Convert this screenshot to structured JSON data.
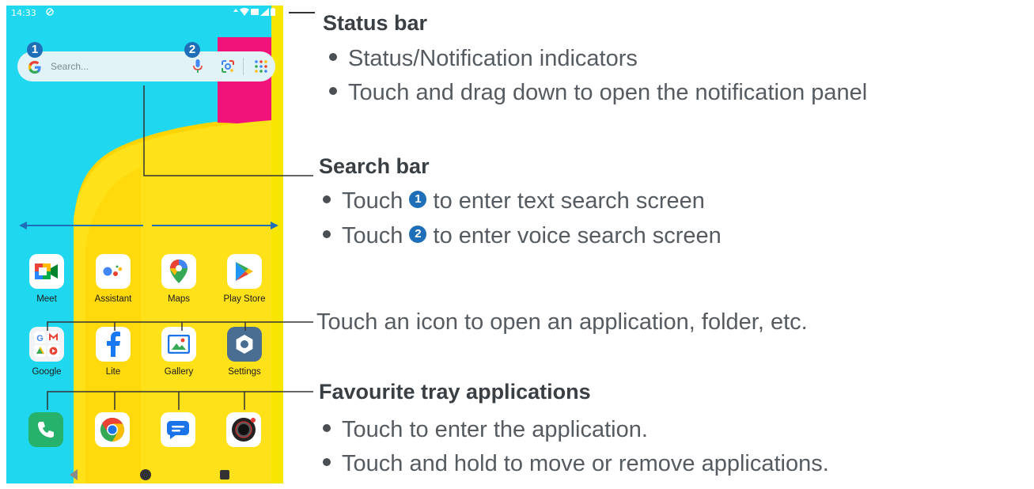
{
  "status_bar": {
    "time": "14:33"
  },
  "search_bar": {
    "placeholder": "Search...",
    "badge_1": "1",
    "badge_2": "2"
  },
  "home_apps": [
    {
      "label": "Meet",
      "icon": "meet-icon"
    },
    {
      "label": "Assistant",
      "icon": "assistant-icon"
    },
    {
      "label": "Maps",
      "icon": "maps-icon"
    },
    {
      "label": "Play Store",
      "icon": "play-store-icon"
    },
    {
      "label": "Google",
      "icon": "google-folder-icon"
    },
    {
      "label": "Lite",
      "icon": "facebook-lite-icon"
    },
    {
      "label": "Gallery",
      "icon": "gallery-icon"
    },
    {
      "label": "Settings",
      "icon": "settings-icon"
    }
  ],
  "dock_apps": [
    {
      "icon": "phone-icon"
    },
    {
      "icon": "chrome-icon"
    },
    {
      "icon": "messages-icon"
    },
    {
      "icon": "camera-icon"
    }
  ],
  "annotations": {
    "status_bar": {
      "title": "Status bar",
      "bullets": [
        "Status/Notification indicators",
        "Touch and drag down to open the notification panel"
      ]
    },
    "search_bar": {
      "title": "Search bar",
      "b1_pre": "Touch",
      "b1_num": "1",
      "b1_post": "to enter text search screen",
      "b2_pre": "Touch",
      "b2_num": "2",
      "b2_post": "to enter voice search screen"
    },
    "icons": {
      "text": "Touch an icon to open an application, folder, etc."
    },
    "tray": {
      "title": "Favourite tray applications",
      "bullets": [
        "Touch to enter the application.",
        "Touch and hold to move or remove applications."
      ]
    }
  },
  "colors": {
    "wallpaper_cyan": "#1fd8ef",
    "wallpaper_yellow": "#ffd400",
    "wallpaper_pink": "#f2137a",
    "badge_blue": "#1f6fb8",
    "leader_line": "#1f6fb8"
  }
}
